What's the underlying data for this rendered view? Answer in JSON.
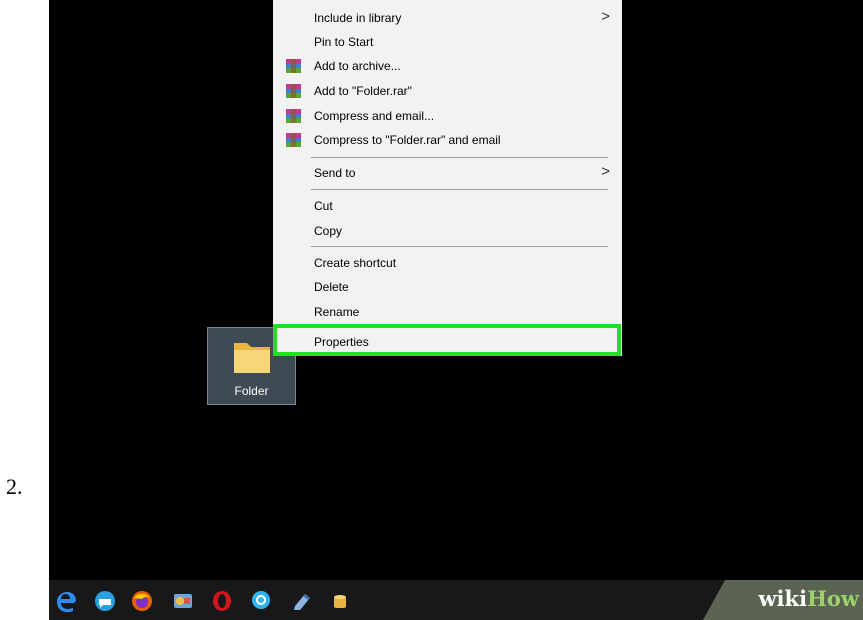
{
  "step": {
    "number": "2."
  },
  "desktop": {
    "folder": {
      "label": "Folder"
    }
  },
  "context_menu": {
    "items": [
      {
        "label": "Include in library",
        "submenu": true
      },
      {
        "label": "Pin to Start",
        "submenu": false
      },
      {
        "label": "Add to archive...",
        "icon": "winrar-icon",
        "submenu": false
      },
      {
        "label": "Add to \"Folder.rar\"",
        "icon": "winrar-icon",
        "submenu": false
      },
      {
        "label": "Compress and email...",
        "icon": "winrar-icon",
        "submenu": false
      },
      {
        "label": "Compress to \"Folder.rar\" and email",
        "icon": "winrar-icon",
        "submenu": false
      },
      {
        "label": "Send to",
        "submenu": true
      },
      {
        "label": "Cut",
        "submenu": false
      },
      {
        "label": "Copy",
        "submenu": false
      },
      {
        "label": "Create shortcut",
        "submenu": false
      },
      {
        "label": "Delete",
        "submenu": false
      },
      {
        "label": "Rename",
        "submenu": false
      },
      {
        "label": "Properties",
        "submenu": false,
        "highlighted": true
      }
    ],
    "submenu_arrow": ">",
    "highlight_color": "#22e022"
  },
  "taskbar": {
    "icons": [
      "edge-icon",
      "chat-icon",
      "firefox-icon",
      "control-panel-icon",
      "opera-icon",
      "messenger-icon",
      "notepad-icon",
      "storage-icon"
    ]
  },
  "watermark": {
    "part1": "wiki",
    "part2": "How"
  }
}
